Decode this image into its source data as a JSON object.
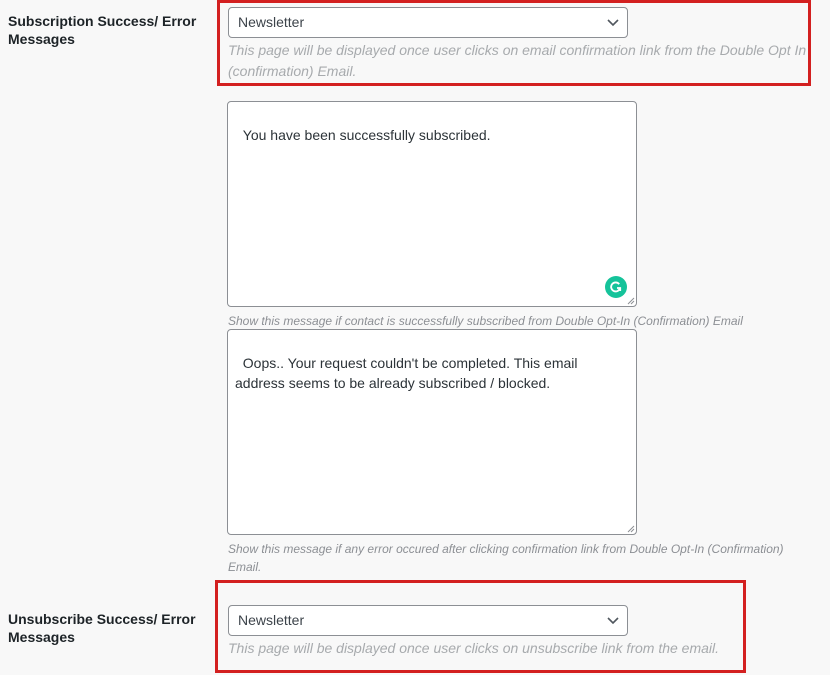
{
  "subscription": {
    "label": "Subscription Success/ Error Messages",
    "select_value": "Newsletter",
    "description": "This page will be displayed once user clicks on email confirmation link from the Double Opt In (confirmation) Email.",
    "success_message": "You have been successfully subscribed.",
    "success_help": "Show this message if contact is successfully subscribed from Double Opt-In (Confirmation) Email",
    "error_message": "Oops.. Your request couldn't be completed. This email address seems to be already subscribed / blocked.",
    "error_help": "Show this message if any error occured after clicking confirmation link from Double Opt-In (Confirmation) Email."
  },
  "unsubscribe": {
    "label": "Unsubscribe Success/ Error Messages",
    "select_value": "Newsletter",
    "description": "This page will be displayed once user clicks on unsubscribe link from the email."
  },
  "colors": {
    "highlight_border": "#d32020",
    "grammarly": "#15c39a"
  },
  "icons": [
    "chevron-down-icon",
    "grammarly-icon",
    "resize-handle-icon"
  ]
}
